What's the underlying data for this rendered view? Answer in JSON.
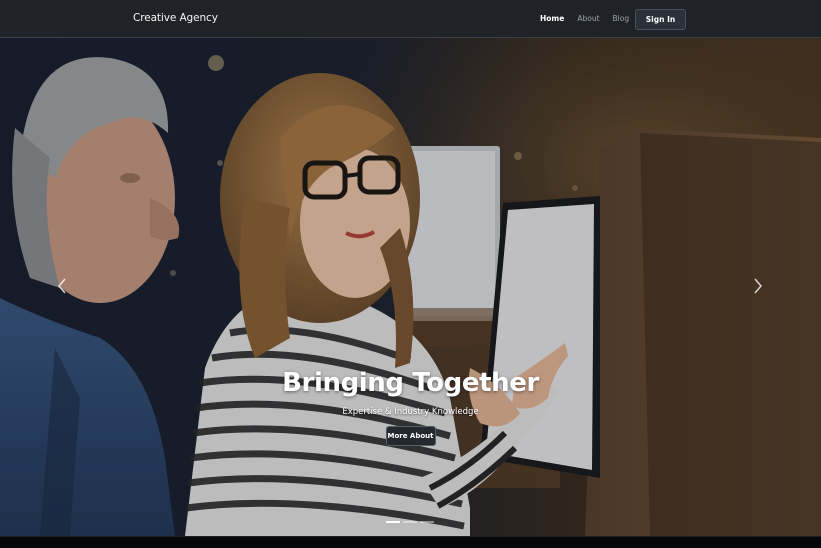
{
  "navbar": {
    "brand": "Creative Agency",
    "links": [
      {
        "label": "Home",
        "active": true
      },
      {
        "label": "About",
        "active": false
      },
      {
        "label": "Blog",
        "active": false
      }
    ],
    "signin_label": "Sign In"
  },
  "hero": {
    "title": "Bringing Together",
    "subtitle": "Expertise & Industry Knowledge",
    "button_label": "More About",
    "slide_count": 3,
    "active_slide": 1
  },
  "icons": {
    "prev": "chevron-left-icon",
    "next": "chevron-right-icon"
  },
  "colors": {
    "navbar_bg": "#1f2327",
    "button_bg": "#23292f",
    "accent": "#ffffff"
  }
}
